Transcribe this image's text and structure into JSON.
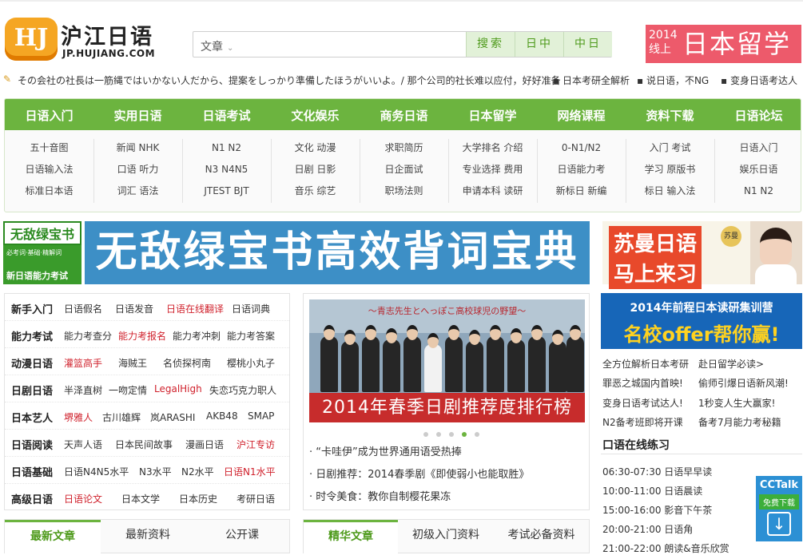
{
  "header": {
    "logo_mark": "HJ",
    "logo_cn": "沪江日语",
    "logo_en": "JP.HUJIANG.COM",
    "search": {
      "category": "文章",
      "buttons": [
        "搜索",
        "日中",
        "中日"
      ]
    },
    "promo": {
      "year": "2014",
      "line": "线上",
      "title": "日本留学展"
    }
  },
  "ticker": [
    "その会社の社長は一筋縄ではいかない人だから、提案をしっかり準備したほうがいいよ。/ 那个公司的社长难以应付，好好准备",
    "日本考研全解析",
    "说日语，不NG",
    "变身日语考达人"
  ],
  "nav": {
    "tabs": [
      "日语入门",
      "实用日语",
      "日语考试",
      "文化娱乐",
      "商务日语",
      "日本留学",
      "网络课程",
      "资料下载",
      "日语论坛"
    ],
    "columns": [
      [
        "五十音图",
        "日语输入法",
        "标准日本语"
      ],
      [
        "新闻 NHK",
        "口语 听力",
        "词汇 语法"
      ],
      [
        "N1 N2",
        "N3 N4N5",
        "JTEST BJT"
      ],
      [
        "文化 动漫",
        "日剧 日影",
        "音乐 综艺"
      ],
      [
        "求职简历",
        "日企面试",
        "职场法则"
      ],
      [
        "大学排名 介绍",
        "专业选择 费用",
        "申请本科 读研"
      ],
      [
        "0-N1/N2",
        "日语能力考",
        "新标日 新编"
      ],
      [
        "入门 考试",
        "学习 原版书",
        "标日 输入法"
      ],
      [
        "日语入门",
        "娱乐日语",
        "N1 N2"
      ]
    ]
  },
  "banners": {
    "left_title": "无敌绿宝书",
    "left_sub1": "必考词·基础·精解词",
    "left_sub2": "新日语能力考试",
    "center": "无敌绿宝书高效背词宝典",
    "right_line1": "苏曼日语",
    "right_line2": "马上来习",
    "right_badge": "苏曼"
  },
  "categories": [
    {
      "head": "新手入门",
      "items": [
        {
          "t": "日语假名"
        },
        {
          "t": "日语发音"
        },
        {
          "t": "日语在线翻译",
          "red": true
        },
        {
          "t": "日语词典"
        }
      ]
    },
    {
      "head": "能力考试",
      "items": [
        {
          "t": "能力考查分"
        },
        {
          "t": "能力考报名",
          "red": true
        },
        {
          "t": "能力考冲刺"
        },
        {
          "t": "能力考答案"
        }
      ]
    },
    {
      "head": "动漫日语",
      "items": [
        {
          "t": "灌篮高手",
          "red": true
        },
        {
          "t": "海贼王"
        },
        {
          "t": "名侦探柯南"
        },
        {
          "t": "樱桃小丸子"
        }
      ]
    },
    {
      "head": "日剧日语",
      "items": [
        {
          "t": "半泽直树"
        },
        {
          "t": "一吻定情"
        },
        {
          "t": "LegalHigh",
          "red": true
        },
        {
          "t": "失恋巧克力职人"
        }
      ]
    },
    {
      "head": "日本艺人",
      "items": [
        {
          "t": "堺雅人",
          "red": true
        },
        {
          "t": "古川雄辉"
        },
        {
          "t": "岚ARASHI"
        },
        {
          "t": "AKB48"
        },
        {
          "t": "SMAP"
        }
      ]
    },
    {
      "head": "日语阅读",
      "items": [
        {
          "t": "天声人语"
        },
        {
          "t": "日本民间故事"
        },
        {
          "t": "漫画日语"
        },
        {
          "t": "沪江专访",
          "red": true
        }
      ]
    },
    {
      "head": "日语基础",
      "items": [
        {
          "t": "日语N4N5水平"
        },
        {
          "t": "N3水平"
        },
        {
          "t": "N2水平"
        },
        {
          "t": "日语N1水平",
          "red": true
        }
      ]
    },
    {
      "head": "高级日语",
      "items": [
        {
          "t": "日语论文",
          "red": true
        },
        {
          "t": "日本文学"
        },
        {
          "t": "日本历史"
        },
        {
          "t": "考研日语"
        }
      ]
    }
  ],
  "feature": {
    "subtitle": "～青志先生とへっぽこ高校球児の野望～",
    "caption": "2014年春季日剧推荐度排行榜",
    "news": [
      "“卡哇伊”成为世界通用语受热捧",
      "日剧推荐：2014春季剧《即使弱小也能取胜》",
      "时令美食：教你自制樱花果冻"
    ]
  },
  "right": {
    "banner_l1": "2014年前程日本读研集训营",
    "banner_l2": "名校offer帮你赢!",
    "links": [
      [
        "全方位解析日本考研",
        "赴日留学必读>"
      ],
      [
        "罪恶之城国内首映!",
        "偷师引爆日语新风潮!"
      ],
      [
        "变身日语考试达人!",
        "1秒变人生大赢家!"
      ],
      [
        "N2备考班即将开课",
        "备考7月能力考秘籍"
      ]
    ],
    "oral_title": "口语在线练习",
    "schedule": [
      "06:30-07:30 日语早早读",
      "10:00-11:00 日语晨读",
      "15:00-16:00 影音下午茶",
      "20:00-21:00 日语角",
      "21:00-22:00 朗读&音乐欣赏"
    ],
    "cctalk_name": "CCTalk",
    "cctalk_dl": "免费下载"
  },
  "tabs_left": [
    "最新文章",
    "最新资料",
    "公开课"
  ],
  "tabs_mid": [
    "精华文章",
    "初级入门资料",
    "考试必备资料"
  ],
  "colors": {
    "green": "#6cb43f",
    "red": "#d0222d",
    "promo": "#ed5a6b"
  }
}
